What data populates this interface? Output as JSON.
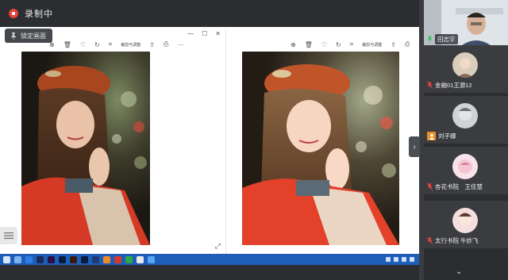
{
  "recording": {
    "label": "录制中"
  },
  "lock_screen": {
    "label": "锁定画面"
  },
  "viewer": {
    "toolbar_text": "裁剪与调整"
  },
  "participants": [
    {
      "name": "田志宇"
    },
    {
      "name": "金融01王源12"
    },
    {
      "name": "刘子娜"
    },
    {
      "name": "杏花书院　王佳慧"
    },
    {
      "name": "太行书院 牛妙飞"
    }
  ],
  "colors": {
    "recording_red": "#e0453a",
    "taskbar_blue": "#1d5fb8",
    "panel_bg": "#2b2d31",
    "tile_bg": "#3a3c40"
  }
}
